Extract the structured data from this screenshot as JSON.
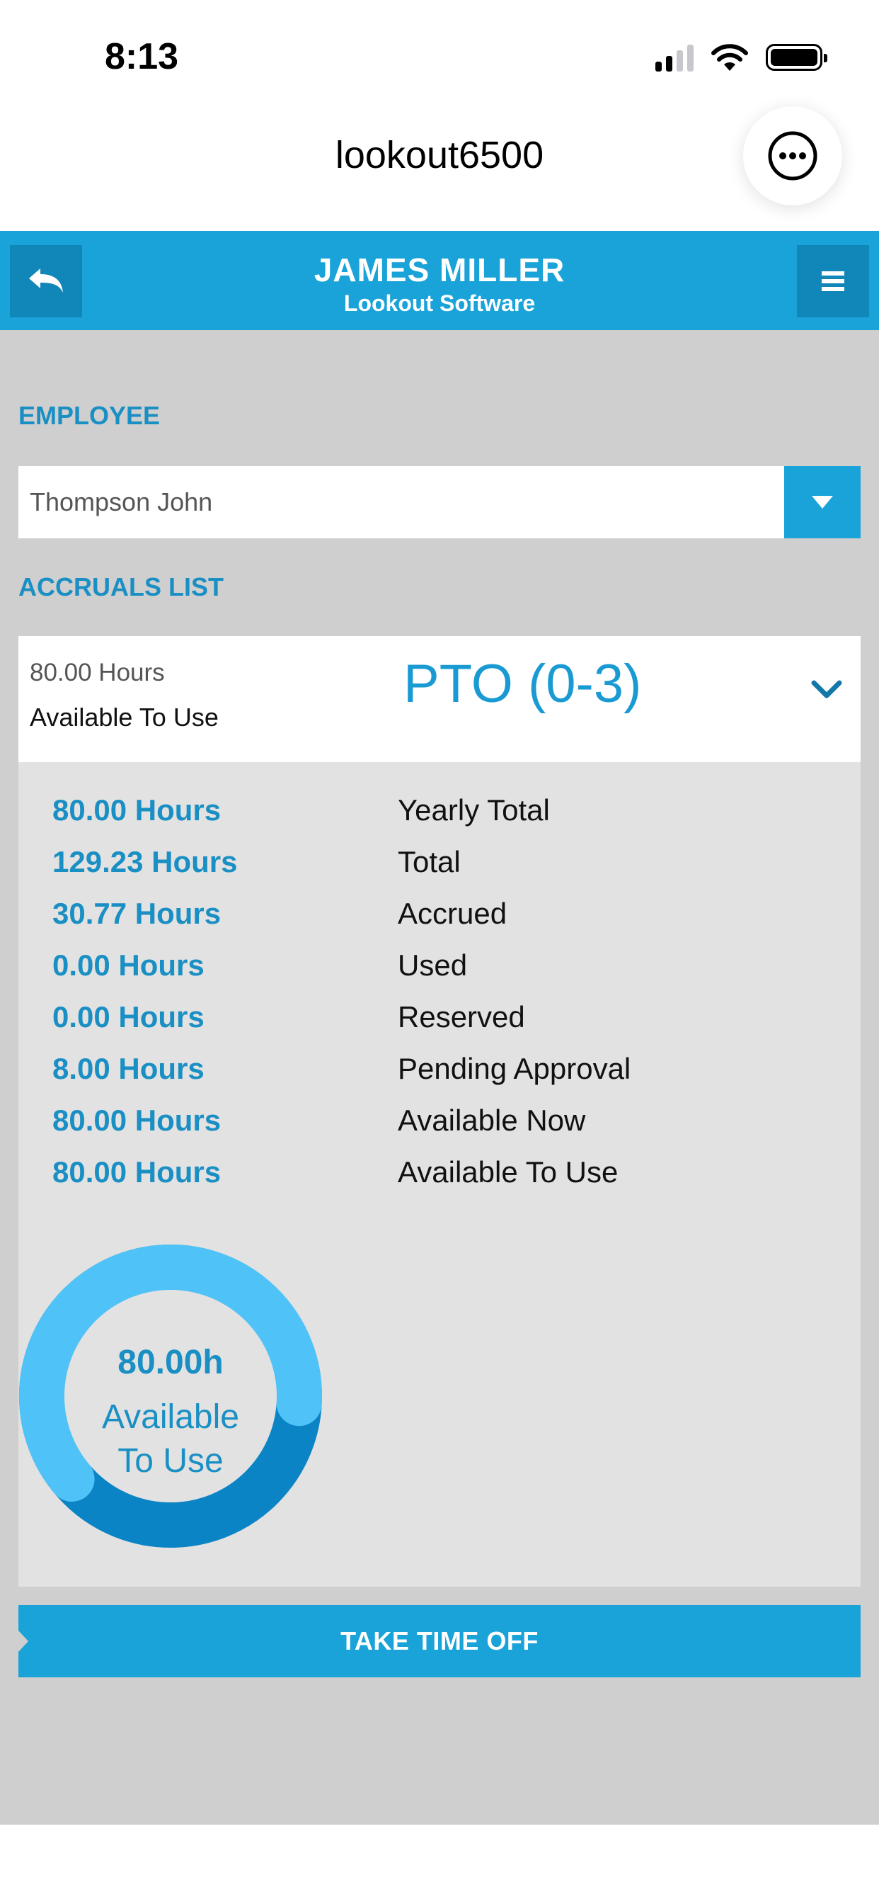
{
  "status_bar": {
    "time": "8:13"
  },
  "browser": {
    "title": "lookout6500"
  },
  "header": {
    "name": "JAMES MILLER",
    "company": "Lookout Software"
  },
  "employee": {
    "label": "EMPLOYEE",
    "selected": "Thompson John"
  },
  "accruals": {
    "label": "ACCRUALS LIST",
    "item": {
      "hours": "80.00 Hours",
      "hours_caption": "Available To Use",
      "name": "PTO (0-3)",
      "rows": [
        {
          "value": "80.00 Hours",
          "label": "Yearly Total"
        },
        {
          "value": "129.23 Hours",
          "label": "Total"
        },
        {
          "value": "30.77 Hours",
          "label": "Accrued"
        },
        {
          "value": "0.00 Hours",
          "label": "Used"
        },
        {
          "value": "0.00 Hours",
          "label": "Reserved"
        },
        {
          "value": "8.00 Hours",
          "label": "Pending Approval"
        },
        {
          "value": "80.00 Hours",
          "label": "Available Now"
        },
        {
          "value": "80.00 Hours",
          "label": "Available To Use"
        }
      ],
      "donut": {
        "value": "80.00h",
        "label_line1": "Available",
        "label_line2": "To Use",
        "fraction_available": 0.62
      }
    }
  },
  "actions": {
    "take_time_off": "TAKE TIME OFF"
  },
  "colors": {
    "accent": "#1aa3d8",
    "accent_dark": "#1186b8",
    "donut_light": "#4fc3f7",
    "donut_dark": "#0b84c6"
  }
}
